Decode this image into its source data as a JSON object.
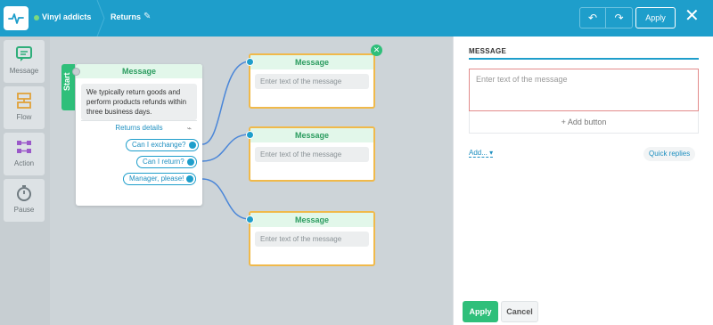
{
  "header": {
    "bot_name": "Vinyl addicts",
    "flow_name": "Returns",
    "apply_label": "Apply",
    "close_glyph": "✕",
    "undo_icon": "undo-icon",
    "redo_icon": "redo-icon",
    "status_color": "#7dd87d"
  },
  "palette": [
    {
      "label": "Message",
      "icon": "message-icon"
    },
    {
      "label": "Flow",
      "icon": "flow-icon"
    },
    {
      "label": "Action",
      "icon": "action-icon"
    },
    {
      "label": "Pause",
      "icon": "pause-icon"
    }
  ],
  "start_node": {
    "tab_label": "Start",
    "title": "Message",
    "text": "We typically return goods and perform products refunds within three business days.",
    "button_label": "Returns details",
    "quick_replies": [
      "Can I exchange?",
      "Can I return?",
      "Manager, please!"
    ]
  },
  "message_nodes": [
    {
      "title": "Message",
      "placeholder": "Enter text of the message"
    },
    {
      "title": "Message",
      "placeholder": "Enter text of the message"
    },
    {
      "title": "Message",
      "placeholder": "Enter text of the message"
    }
  ],
  "panel": {
    "title": "MESSAGE",
    "placeholder": "Enter text of the message",
    "add_button": "+ Add button",
    "add_menu": "Add...",
    "quick_replies": "Quick replies",
    "apply": "Apply",
    "cancel": "Cancel"
  },
  "colors": {
    "brand": "#1e9ecb",
    "accent_green": "#2fbf7a",
    "node_selected_border": "#f0b94a"
  }
}
